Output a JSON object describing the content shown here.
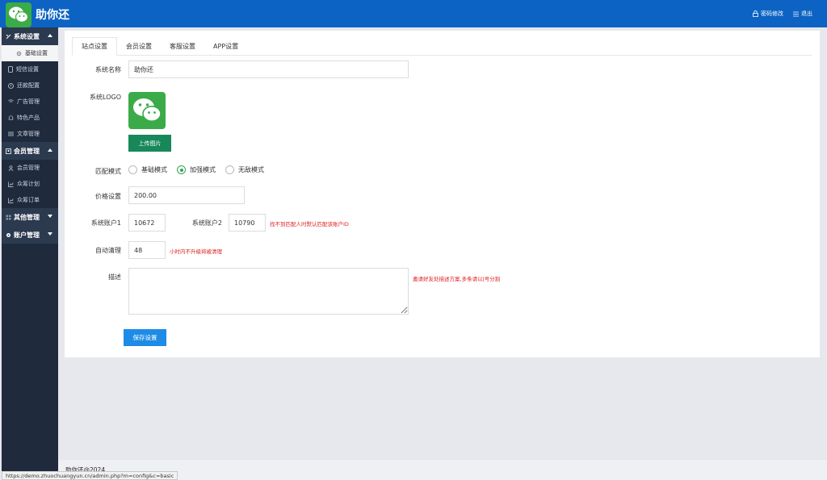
{
  "app": {
    "title": "助你还",
    "brand_color": "#0c63c3",
    "logo_icon": "wechat-icon"
  },
  "top_actions": {
    "password": "密码修改",
    "logout": "退出"
  },
  "sidebar": {
    "groups": [
      {
        "label": "系统设置",
        "expanded": true,
        "items": [
          {
            "label": "基础设置",
            "active": true,
            "icon": "gear-icon"
          },
          {
            "label": "短信设置",
            "icon": "phone-icon"
          },
          {
            "label": "还款配置",
            "icon": "info-icon"
          },
          {
            "label": "广告管理",
            "icon": "wifi-icon"
          },
          {
            "label": "特色产品",
            "icon": "bell-icon"
          },
          {
            "label": "文章管理",
            "icon": "list-icon"
          }
        ]
      },
      {
        "label": "会员管理",
        "expanded": true,
        "items": [
          {
            "label": "会员管理",
            "icon": "user-icon"
          },
          {
            "label": "众筹计划",
            "icon": "chart-icon"
          },
          {
            "label": "众筹订单",
            "icon": "chart-icon"
          }
        ]
      },
      {
        "label": "其他管理",
        "expanded": false,
        "items": []
      },
      {
        "label": "账户管理",
        "expanded": false,
        "items": []
      }
    ]
  },
  "tabs": [
    "站点设置",
    "会员设置",
    "客服设置",
    "APP设置"
  ],
  "form": {
    "site_name_label": "系统名称",
    "site_name_value": "助你还",
    "logo_label": "系统LOGO",
    "upload_button": "上传图片",
    "match_mode_label": "匹配模式",
    "match_modes": [
      "基础模式",
      "加强模式",
      "无敌模式"
    ],
    "match_mode_selected": 1,
    "price_label": "价格设置",
    "price_value": "200.00",
    "account1_label": "系统账户1",
    "account1_value": "10672",
    "account2_label": "系统账户2",
    "account2_value": "10790",
    "account_hint": "找不到匹配人时默认匹配该账户ID",
    "auto_clean_label": "自动清理",
    "auto_clean_value": "48",
    "auto_clean_hint": "小时内不升级将被清理",
    "desc_label": "描述",
    "desc_value": "",
    "desc_hint": "邀请好友处描述方案,多条请以|号分割",
    "save_button": "保存设置"
  },
  "footer": {
    "copyright": "助你还@2024"
  },
  "status_bar": {
    "url": "https://demo.zhuochuangyun.cn/admin.php?m=config&c=basic"
  }
}
